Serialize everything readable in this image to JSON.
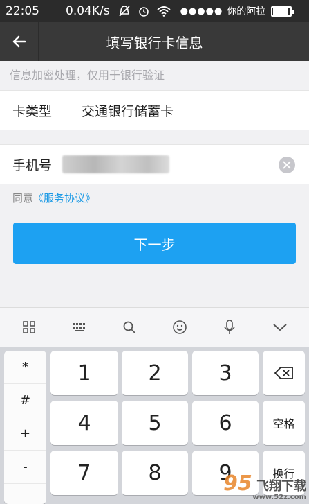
{
  "status_bar": {
    "time": "22:05",
    "net_speed": "0.04K/s",
    "carrier": "你的阿拉",
    "signal_dots": "●●●●●"
  },
  "nav": {
    "back_icon": "arrow-left-icon",
    "title": "填写银行卡信息"
  },
  "hint": "信息加密处理，仅用于银行验证",
  "card_type": {
    "label": "卡类型",
    "value": "交通银行储蓄卡"
  },
  "phone": {
    "label": "手机号",
    "clear_icon": "clear-icon"
  },
  "agreement": {
    "prefix": "同意",
    "link": "《服务协议》"
  },
  "next_button": "下一步",
  "keyboard": {
    "symbols": [
      "*",
      "#",
      "+",
      "-"
    ],
    "digits": [
      "1",
      "2",
      "3",
      "4",
      "5",
      "6",
      "7",
      "8",
      "9"
    ],
    "space_label": "空格",
    "enter_label": "换行",
    "backspace_icon": "backspace-icon"
  },
  "watermark": {
    "logo": "95",
    "name": "飞翔下载",
    "url": "www.52z.com"
  },
  "colors": {
    "accent": "#1da1f2",
    "link": "#1e9be5",
    "navbar": "#393939"
  }
}
